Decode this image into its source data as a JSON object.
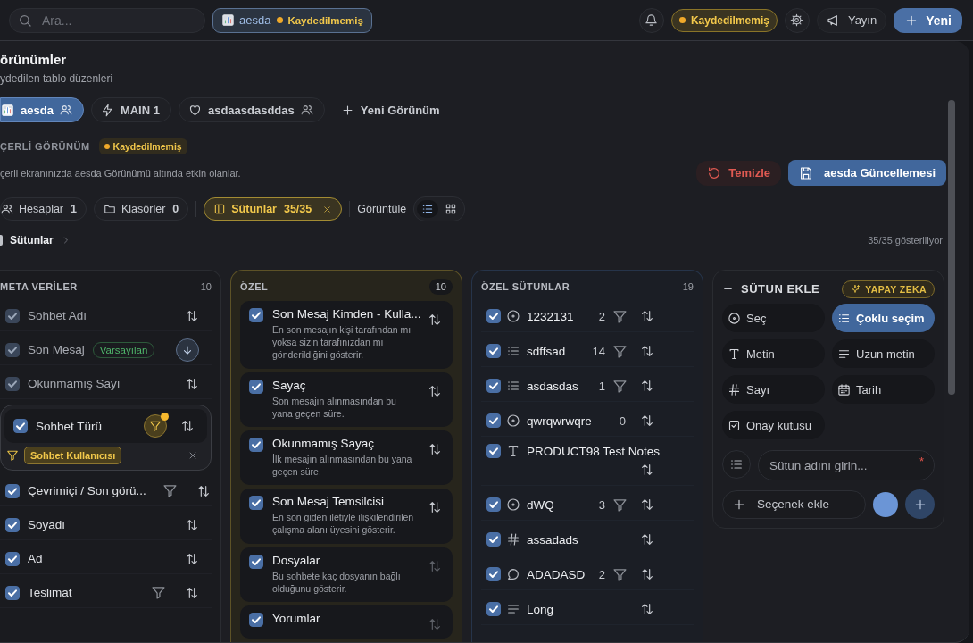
{
  "topbar": {
    "search": {
      "placeholder": "Ara..."
    },
    "view_chip": {
      "name": "aesda",
      "status": "Kaydedilmemiş"
    },
    "status_chip": "Kaydedilmemiş",
    "publish_button": "Yayın",
    "new_button": "Yeni"
  },
  "views_panel": {
    "title": "örünümler",
    "subtitle": "ydedilen tablo düzenleri",
    "views": [
      {
        "name": "aesda",
        "kind": "chart",
        "shared": true,
        "selected": true
      },
      {
        "name": "MAIN 1",
        "kind": "bolt",
        "shared": false,
        "selected": false
      },
      {
        "name": "asdaasdasddas",
        "kind": "heart",
        "shared": true,
        "selected": false
      }
    ],
    "new_view": "Yeni Görünüm",
    "current_label": "ÇERLİ GÖRÜNÜM",
    "current_status": "Kaydedilmemiş",
    "description": "çerli ekranınızda aesda Görünümü altında etkin olanlar.",
    "clear_button": "Temizle",
    "update_button": "aesda Güncellemesi",
    "filters": [
      {
        "kind": "users",
        "label": "Hesaplar",
        "count": "1",
        "selected": false
      },
      {
        "kind": "folder",
        "label": "Klasörler",
        "count": "0",
        "selected": false
      },
      {
        "kind": "columns",
        "label": "Sütunlar",
        "count": "35/35",
        "selected": true
      }
    ],
    "display_label": "Görüntüle",
    "display_modes": [
      {
        "kind": "list",
        "selected": true
      },
      {
        "kind": "grid",
        "selected": false
      }
    ],
    "breadcrumb": "Sütunlar",
    "showing": "35/35 gösteriliyor"
  },
  "groups": [
    {
      "kind": "meta",
      "title": "META VERİLER",
      "count": "10",
      "highlighted": false,
      "items": [
        {
          "label": "Sohbet Adı",
          "checked": true,
          "disabled": true,
          "filter": false,
          "sort_descending": false
        },
        {
          "label": "Son Mesaj",
          "badge": "Varsayılan",
          "checked": true,
          "disabled": true,
          "filter": false,
          "sort_descending": true
        },
        {
          "label": "Okunmamış Sayı",
          "checked": true,
          "disabled": true,
          "filter": false,
          "sort_descending": false
        },
        {
          "label": "Sohbet Türü",
          "checked": true,
          "disabled": false,
          "filter": true,
          "filter_active": true,
          "sort_descending": false,
          "expanded": true,
          "filter_value": "Sohbet Kullanıcısı"
        },
        {
          "label": "Çevrimiçi / Son görü...",
          "checked": true,
          "disabled": false,
          "filter": true,
          "filter_active": false,
          "sort_descending": false
        },
        {
          "label": "Soyadı",
          "checked": true,
          "disabled": false,
          "filter": false,
          "sort_descending": false
        },
        {
          "label": "Ad",
          "checked": true,
          "disabled": false,
          "filter": false,
          "sort_descending": false
        },
        {
          "label": "Teslimat",
          "checked": true,
          "disabled": false,
          "filter": true,
          "filter_active": false,
          "sort_descending": false
        }
      ]
    },
    {
      "kind": "described",
      "title": "ÖZEL",
      "count": "10",
      "highlighted": true,
      "items": [
        {
          "label": "Son Mesaj Kimden - Kulla...",
          "description": "En son mesajın kişi tarafından mı yoksa sizin tarafınızdan mı gönderildiğini gösterir.",
          "checked": true,
          "sortable": true
        },
        {
          "label": "Sayaç",
          "description": "Son mesajın alınmasından bu yana geçen süre.",
          "checked": true,
          "sortable": true
        },
        {
          "label": "Okunmamış Sayaç",
          "description": "İlk mesajın alınmasından bu yana geçen süre.",
          "checked": true,
          "sortable": true
        },
        {
          "label": "Son Mesaj Temsilcisi",
          "description": "En son giden iletiyle ilişkilendirilen çalışma alanı üyesini gösterir.",
          "checked": true,
          "sortable": true
        },
        {
          "label": "Dosyalar",
          "description": "Bu sohbete kaç dosyanın bağlı olduğunu gösterir.",
          "checked": true,
          "sortable": false
        },
        {
          "label": "Yorumlar",
          "checked": true,
          "sortable": false
        }
      ]
    },
    {
      "kind": "custom",
      "title": "ÖZEL SÜTUNLAR",
      "count": "19",
      "highlighted": false,
      "items": [
        {
          "label": "1232131",
          "kind": "select",
          "count": "2",
          "filter": true,
          "checked": true
        },
        {
          "label": "sdffsad",
          "kind": "multi",
          "count": "14",
          "filter": true,
          "checked": true
        },
        {
          "label": "asdasdas",
          "kind": "multi",
          "count": "1",
          "filter": true,
          "checked": true
        },
        {
          "label": "qwrqwrwqre",
          "kind": "select",
          "count": "0",
          "filter": false,
          "checked": true
        },
        {
          "label": "PRODUCT98 Test Notes",
          "kind": "text",
          "filter": false,
          "checked": true
        },
        {
          "label": "dWQ",
          "kind": "select",
          "count": "3",
          "filter": true,
          "checked": true
        },
        {
          "label": "assadads",
          "kind": "number",
          "filter": false,
          "checked": true
        },
        {
          "label": "ADADASD",
          "kind": "comment",
          "count": "2",
          "filter": true,
          "checked": true
        },
        {
          "label": "Long",
          "kind": "longtext",
          "filter": false,
          "checked": true
        }
      ]
    }
  ],
  "add_column": {
    "title": "SÜTUN EKLE",
    "ai_badge": "YAPAY ZEKA",
    "types": [
      {
        "kind": "select",
        "label": "Seç",
        "selected": false
      },
      {
        "kind": "multi",
        "label": "Çoklu seçim",
        "selected": true
      },
      {
        "kind": "text",
        "label": "Metin",
        "selected": false
      },
      {
        "kind": "longtext",
        "label": "Uzun metin",
        "selected": false
      },
      {
        "kind": "number",
        "label": "Sayı",
        "selected": false
      },
      {
        "kind": "date",
        "label": "Tarih",
        "selected": false
      },
      {
        "kind": "checkbox",
        "label": "Onay kutusu",
        "selected": false
      }
    ],
    "name_field": {
      "placeholder": "Sütun adını girin...",
      "required_mark": "*"
    },
    "add_option": "Seçenek ekle"
  }
}
